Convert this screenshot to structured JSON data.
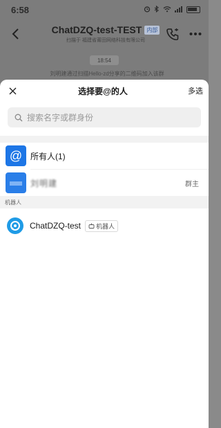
{
  "status_bar": {
    "time": "6:58"
  },
  "chat_header": {
    "title": "ChatDZQ-test-TEST",
    "badge": "内部",
    "subtitle": "扫描于 福建省莆田网络科技有限公司"
  },
  "chat_body": {
    "timestamp": "18:54",
    "notice": "刘明建通过扫描Hello-zd分享的二维码加入该群"
  },
  "sheet": {
    "title": "选择要@的人",
    "multi_select_label": "多选",
    "search": {
      "placeholder": "搜索名字或群身份",
      "value": ""
    },
    "everyone_label": "所有人(1)",
    "owner_row": {
      "name": "刘明建",
      "role": "群主"
    },
    "bots_section_label": "机器人",
    "bot": {
      "name": "ChatDZQ-test",
      "badge": "机器人"
    }
  },
  "colors": {
    "accent": "#1d76e6",
    "bot_avatar": "#1f9be6",
    "overlay": "#7c7c7c"
  }
}
